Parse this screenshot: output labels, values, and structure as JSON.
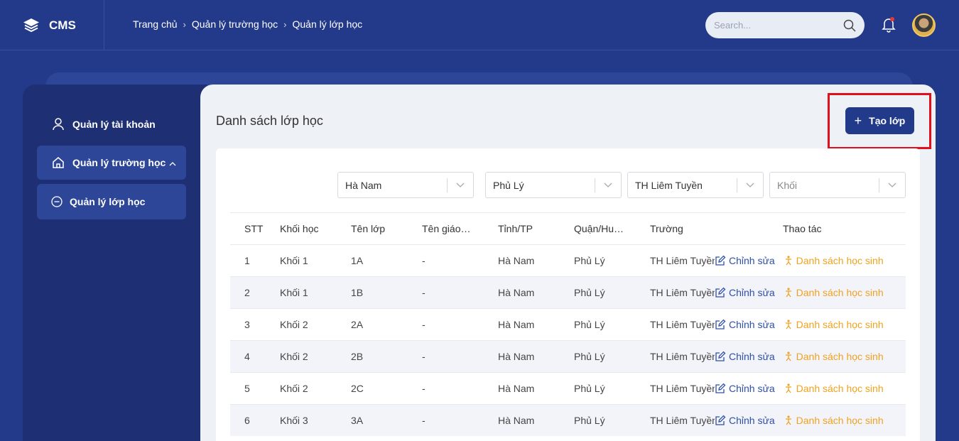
{
  "app": {
    "name": "CMS"
  },
  "breadcrumb": [
    "Trang chủ",
    "Quản lý trường học",
    "Quản lý lớp học"
  ],
  "search": {
    "placeholder": "Search..."
  },
  "sidebar": {
    "items": [
      {
        "label": "Quản lý tài khoản",
        "icon": "user-icon"
      },
      {
        "label": "Quản lý trường học",
        "icon": "home-icon",
        "expanded": true
      },
      {
        "label": "Quản lý lớp học",
        "icon": "minus-circle-icon"
      }
    ]
  },
  "main": {
    "title": "Danh sách lớp học",
    "create_label": "Tạo lớp",
    "filters": [
      {
        "value": "Hà Nam",
        "placeholder": false
      },
      {
        "value": "Phủ Lý",
        "placeholder": false
      },
      {
        "value": "TH Liêm Tuyền",
        "placeholder": false
      },
      {
        "value": "Khối",
        "placeholder": true
      }
    ],
    "columns": [
      "STT",
      "Khối học",
      "Tên lớp",
      "Tên giáo…",
      "Tỉnh/TP",
      "Quận/Hu…",
      "Trường",
      "Thao tác"
    ],
    "edit_label": "Chỉnh sửa",
    "students_label": "Danh sách học sinh",
    "rows": [
      {
        "stt": "1",
        "khoi": "Khối 1",
        "lop": "1A",
        "gv": "-",
        "tinh": "Hà Nam",
        "quan": "Phủ Lý",
        "truong": "TH Liêm Tuyền"
      },
      {
        "stt": "2",
        "khoi": "Khối 1",
        "lop": "1B",
        "gv": "-",
        "tinh": "Hà Nam",
        "quan": "Phủ Lý",
        "truong": "TH Liêm Tuyền"
      },
      {
        "stt": "3",
        "khoi": "Khối 2",
        "lop": "2A",
        "gv": "-",
        "tinh": "Hà Nam",
        "quan": "Phủ Lý",
        "truong": "TH Liêm Tuyền"
      },
      {
        "stt": "4",
        "khoi": "Khối 2",
        "lop": "2B",
        "gv": "-",
        "tinh": "Hà Nam",
        "quan": "Phủ Lý",
        "truong": "TH Liêm Tuyền"
      },
      {
        "stt": "5",
        "khoi": "Khối 2",
        "lop": "2C",
        "gv": "-",
        "tinh": "Hà Nam",
        "quan": "Phủ Lý",
        "truong": "TH Liêm Tuyền"
      },
      {
        "stt": "6",
        "khoi": "Khối 3",
        "lop": "3A",
        "gv": "-",
        "tinh": "Hà Nam",
        "quan": "Phủ Lý",
        "truong": "TH Liêm Tuyền"
      }
    ]
  },
  "colors": {
    "accent": "#223a8a",
    "highlight": "#e3101c",
    "warning": "#f0a21e",
    "link": "#2d4fa6"
  }
}
